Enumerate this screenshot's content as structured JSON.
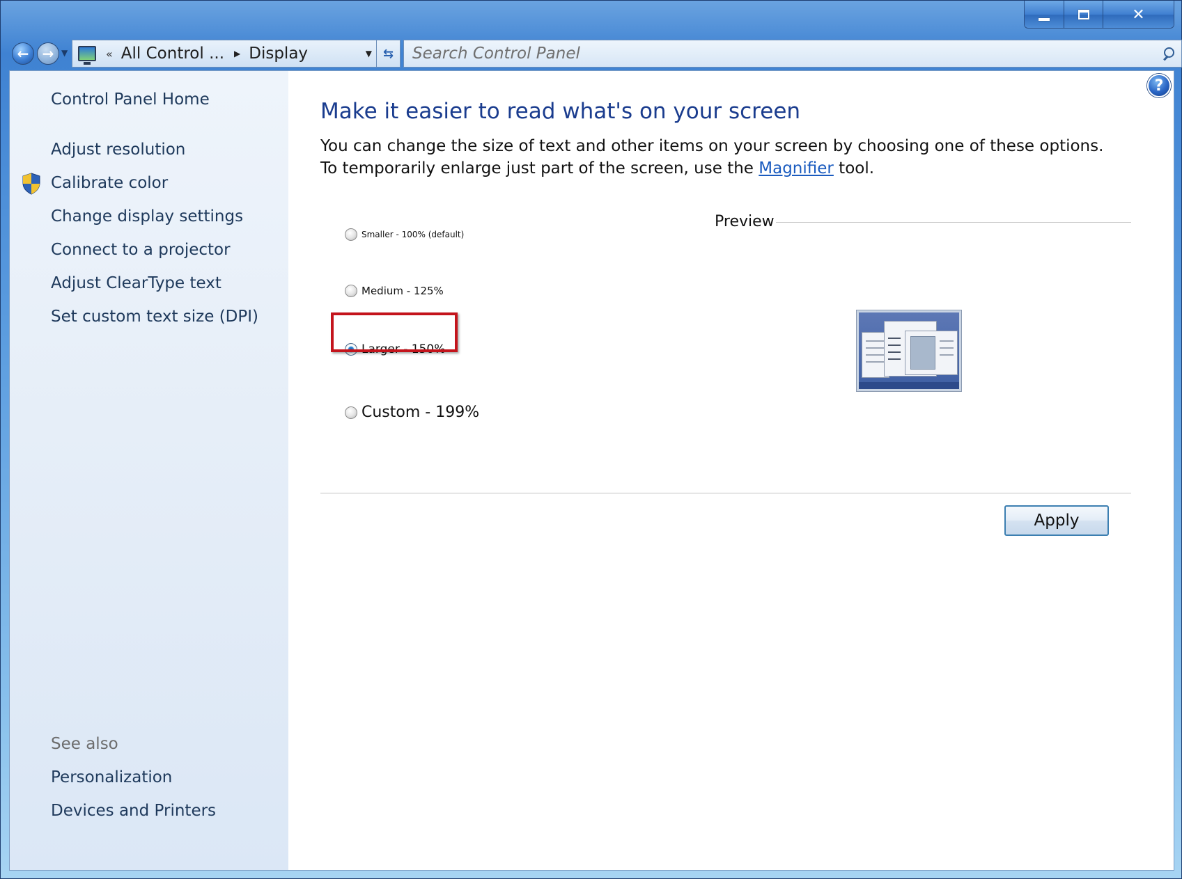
{
  "window": {
    "minimize_icon": "minimize-icon",
    "maximize_icon": "maximize-icon",
    "close_label": "✕"
  },
  "nav": {
    "back_label": "←",
    "forward_label": "→",
    "address_chevrons": "«",
    "crumbs": [
      "All Control ...",
      "Display"
    ],
    "search_placeholder": "Search Control Panel"
  },
  "sidebar": {
    "home": "Control Panel Home",
    "items": [
      "Adjust resolution",
      "Calibrate color",
      "Change display settings",
      "Connect to a projector",
      "Adjust ClearType text",
      "Set custom text size (DPI)"
    ],
    "see_also_heading": "See also",
    "see_also_items": [
      "Personalization",
      "Devices and Printers"
    ]
  },
  "main": {
    "title": "Make it easier to read what's on your screen",
    "desc_before": "You can change the size of text and other items on your screen by choosing one of these options. To temporarily enlarge just part of the screen, use the ",
    "desc_link": "Magnifier",
    "desc_after": " tool.",
    "options": [
      {
        "label": "Smaller - 100% (default)",
        "checked": false
      },
      {
        "label": "Medium - 125%",
        "checked": false
      },
      {
        "label": "Larger - 150%",
        "checked": true
      },
      {
        "label": "Custom - 199%",
        "checked": false
      }
    ],
    "preview_label": "Preview",
    "apply_label": "Apply"
  },
  "colors": {
    "title_blue": "#1a3c8e",
    "link_blue": "#1a5bbf",
    "highlight_red": "#c4141c"
  }
}
